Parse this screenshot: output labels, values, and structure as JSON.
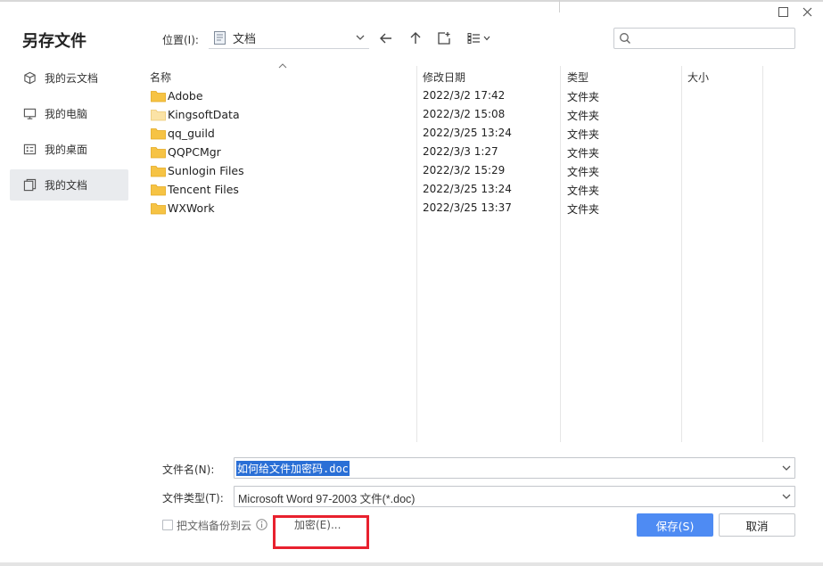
{
  "dialog": {
    "title": "另存文件"
  },
  "sidebar": {
    "items": [
      {
        "label": "我的云文档",
        "icon": "cube-icon"
      },
      {
        "label": "我的电脑",
        "icon": "monitor-icon"
      },
      {
        "label": "我的桌面",
        "icon": "desktop-icon"
      },
      {
        "label": "我的文档",
        "icon": "documents-icon",
        "active": true
      }
    ]
  },
  "toolbar": {
    "location_label": "位置(I):",
    "location_value": "文档",
    "search_placeholder": ""
  },
  "file_list": {
    "columns": {
      "name": "名称",
      "date": "修改日期",
      "type": "类型",
      "size": "大小"
    },
    "rows": [
      {
        "name": "Adobe",
        "date": "2022/3/2 17:42",
        "type": "文件夹"
      },
      {
        "name": "KingsoftData",
        "date": "2022/3/2 15:08",
        "type": "文件夹"
      },
      {
        "name": "qq_guild",
        "date": "2022/3/25 13:24",
        "type": "文件夹"
      },
      {
        "name": "QQPCMgr",
        "date": "2022/3/3 1:27",
        "type": "文件夹"
      },
      {
        "name": "Sunlogin Files",
        "date": "2022/3/2 15:29",
        "type": "文件夹"
      },
      {
        "name": "Tencent Files",
        "date": "2022/3/25 13:24",
        "type": "文件夹"
      },
      {
        "name": "WXWork",
        "date": "2022/3/25 13:37",
        "type": "文件夹"
      }
    ]
  },
  "form": {
    "filename_label": "文件名(N):",
    "filename_value": "如何给文件加密码.doc",
    "filetype_label": "文件类型(T):",
    "filetype_value": "Microsoft Word 97-2003 文件(*.doc)",
    "backup_label": "把文档备份到云",
    "encrypt_label": "加密(E)...",
    "save_label": "保存(S)",
    "cancel_label": "取消"
  },
  "colors": {
    "accent": "#4e8bf3",
    "selection": "#2a6fd6",
    "highlight_box": "#e8212e",
    "folder": "#f6c344"
  }
}
